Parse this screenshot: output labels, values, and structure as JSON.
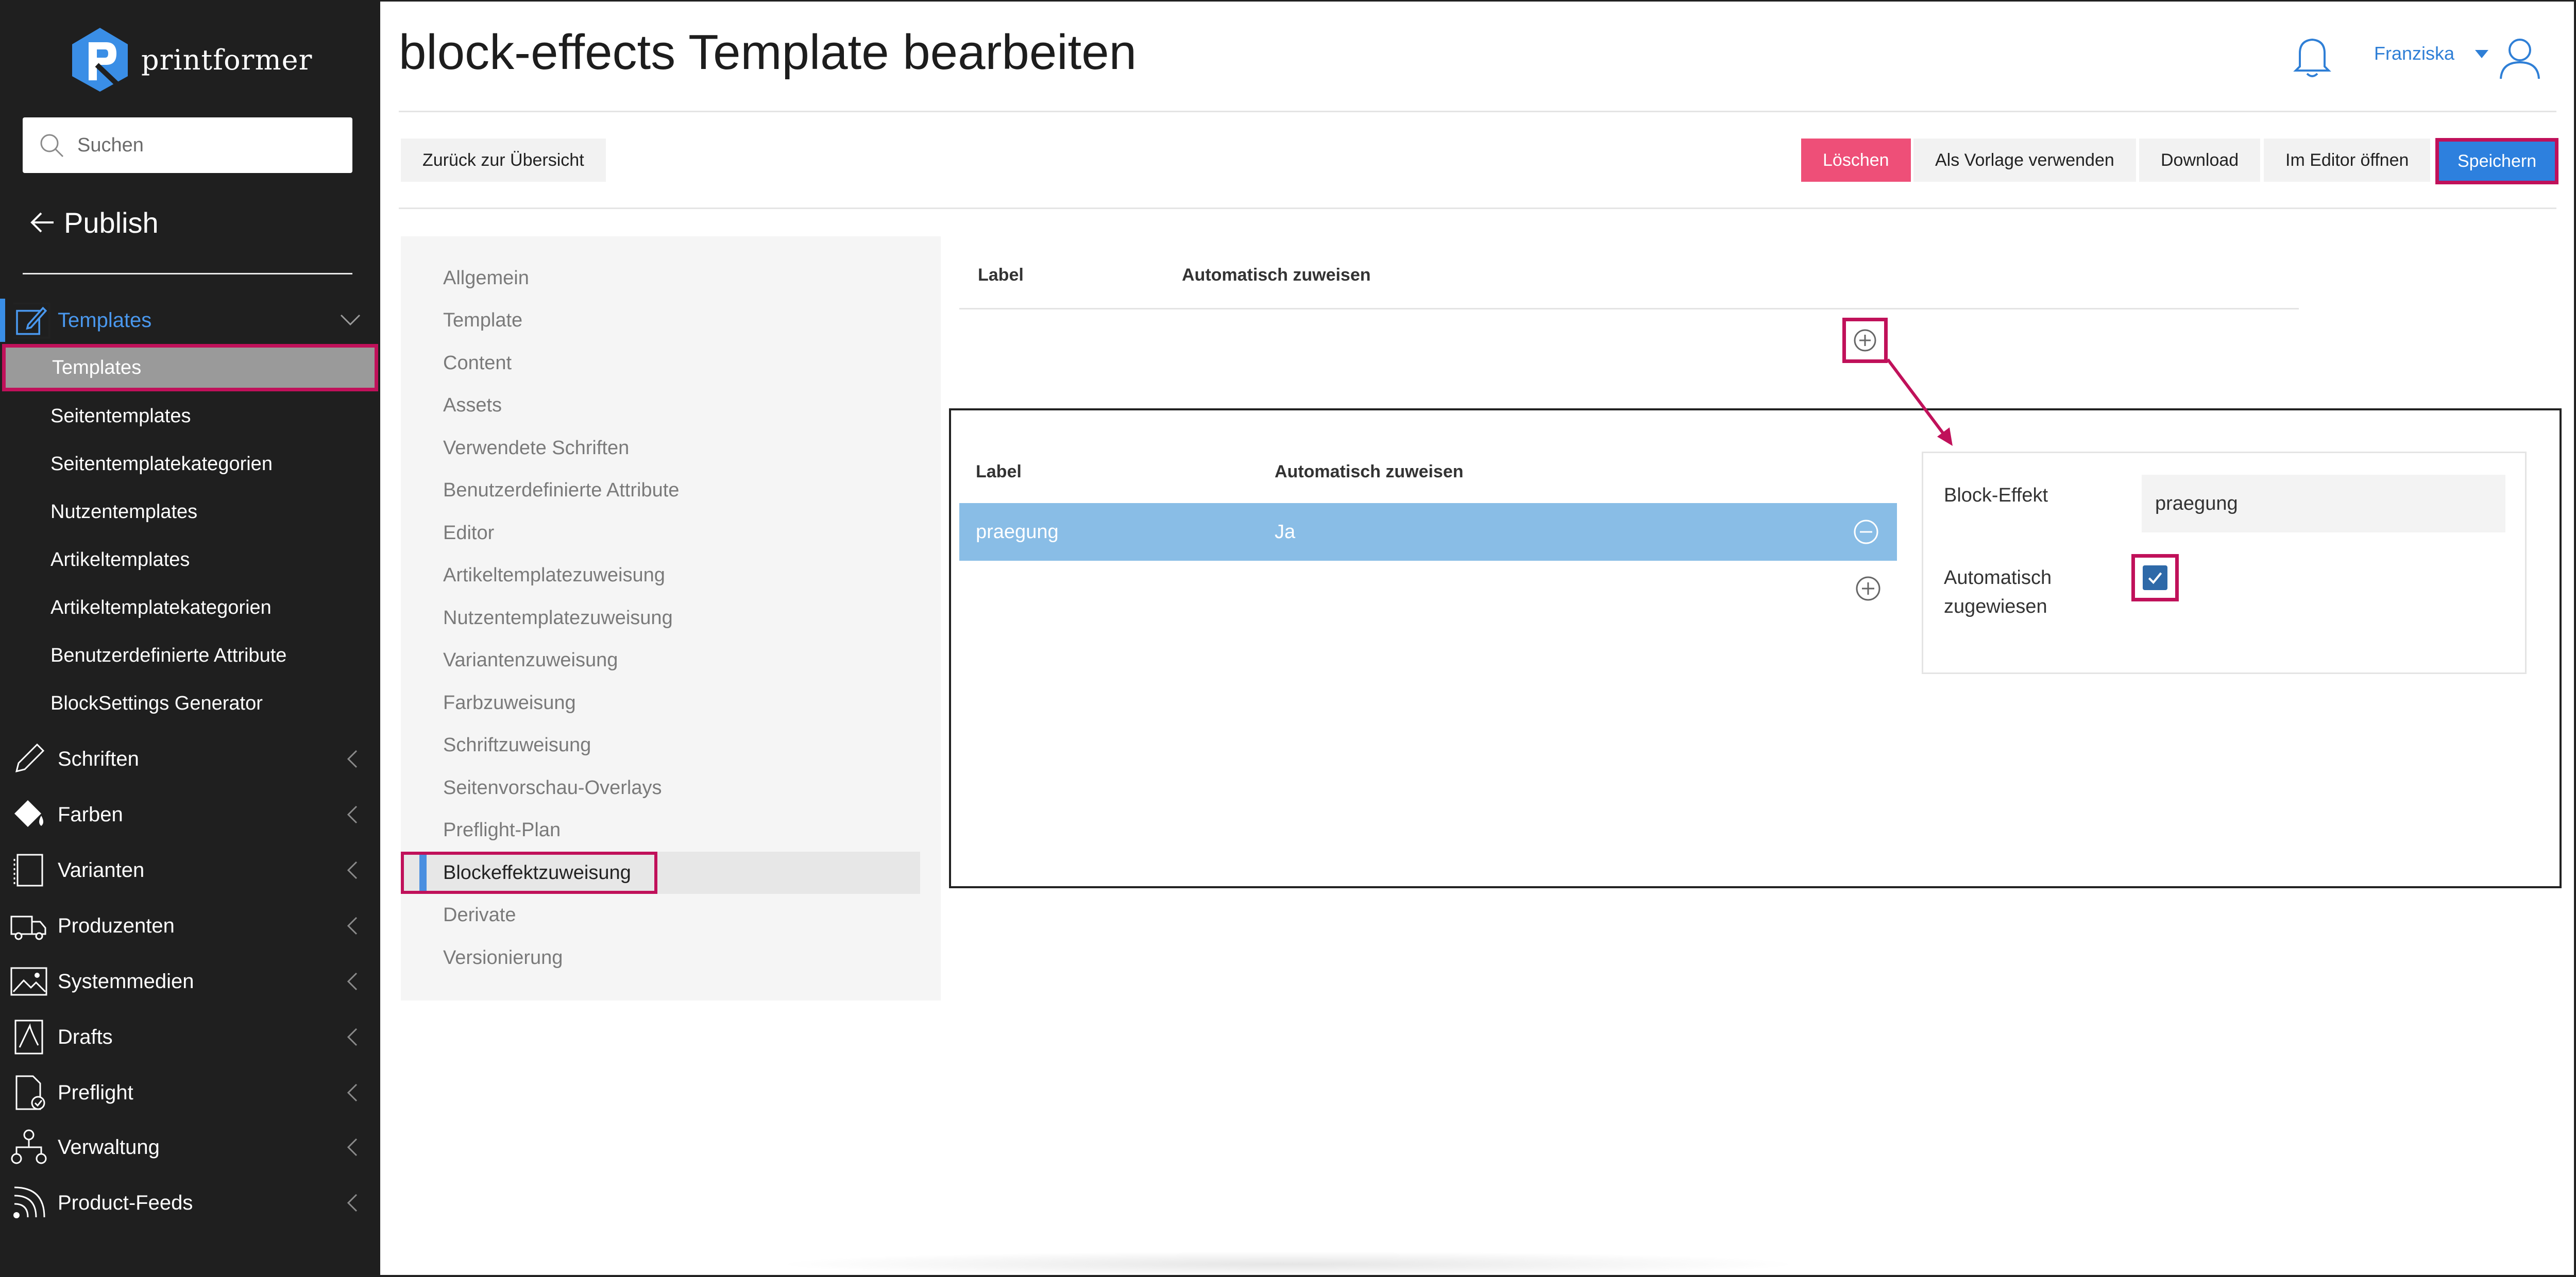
{
  "brand": {
    "name": "printformer"
  },
  "sidebar": {
    "search_placeholder": "Suchen",
    "section_title": "Publish",
    "templates_group": {
      "label": "Templates",
      "active_item": "Templates",
      "items": [
        "Seitentemplates",
        "Seitentemplatekategorien",
        "Nutzentemplates",
        "Artikeltemplates",
        "Artikeltemplatekategorien",
        "Benutzerdefinierte Attribute",
        "BlockSettings Generator"
      ]
    },
    "nav": [
      {
        "label": "Schriften",
        "icon": "pencil-icon"
      },
      {
        "label": "Farben",
        "icon": "paint-bucket-icon"
      },
      {
        "label": "Varianten",
        "icon": "variants-icon"
      },
      {
        "label": "Produzenten",
        "icon": "truck-icon"
      },
      {
        "label": "Systemmedien",
        "icon": "image-icon"
      },
      {
        "label": "Drafts",
        "icon": "pdf-icon"
      },
      {
        "label": "Preflight",
        "icon": "document-check-icon"
      },
      {
        "label": "Verwaltung",
        "icon": "org-chart-icon"
      },
      {
        "label": "Product-Feeds",
        "icon": "rss-icon"
      }
    ],
    "accent_color": "#4a98ee"
  },
  "header": {
    "title": "block-effects Template bearbeiten",
    "user": "Franziska"
  },
  "toolbar": {
    "back_label": "Zurück zur Übersicht",
    "delete_label": "Löschen",
    "as_template_label": "Als Vorlage verwenden",
    "download_label": "Download",
    "open_editor_label": "Im Editor öffnen",
    "save_label": "Speichern"
  },
  "tabs": {
    "items": [
      "Allgemein",
      "Template",
      "Content",
      "Assets",
      "Verwendete Schriften",
      "Benutzerdefinierte Attribute",
      "Editor",
      "Artikeltemplatezuweisung",
      "Nutzentemplatezuweisung",
      "Variantenzuweisung",
      "Farbzuweisung",
      "Schriftzuweisung",
      "Seitenvorschau-Overlays",
      "Preflight-Plan",
      "Blockeffektzuweisung",
      "Derivate",
      "Versionierung"
    ],
    "active": "Blockeffektzuweisung"
  },
  "table": {
    "col_label": "Label",
    "col_auto": "Automatisch zuweisen"
  },
  "detail": {
    "rows": [
      {
        "label": "praegung",
        "auto": "Ja"
      }
    ],
    "form": {
      "effect_label": "Block-Effekt",
      "effect_value": "praegung",
      "auto_label": "Automatisch zugewiesen",
      "auto_checked": true
    }
  },
  "colors": {
    "highlight": "#c0115a",
    "primary": "#2d80de",
    "danger": "#ee4f78",
    "selected_row": "#89bde6",
    "sidebar_bg": "#1f1f1f"
  }
}
